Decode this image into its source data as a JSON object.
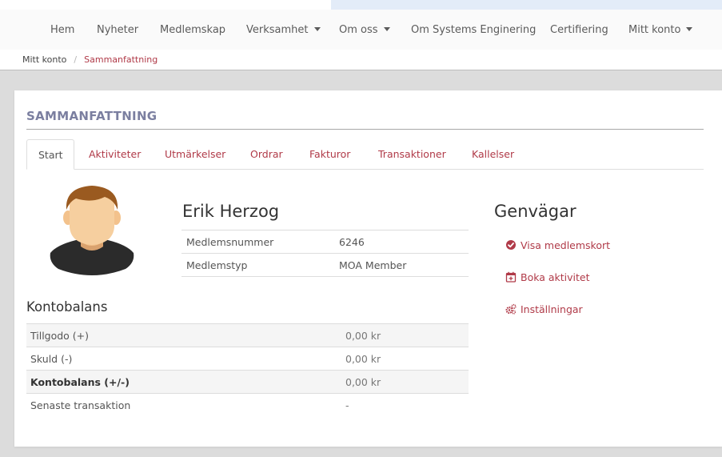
{
  "nav": {
    "items": [
      {
        "label": "Hem",
        "dropdown": false
      },
      {
        "label": "Nyheter",
        "dropdown": false
      },
      {
        "label": "Medlemskap",
        "dropdown": false
      },
      {
        "label": "Verksamhet",
        "dropdown": true
      },
      {
        "label": "Om oss",
        "dropdown": true
      },
      {
        "label": "Om Systems Enginering",
        "dropdown": false
      },
      {
        "label": "Certifiering",
        "dropdown": false
      },
      {
        "label": "Mitt konto",
        "dropdown": true
      }
    ]
  },
  "breadcrumb": {
    "home": "Mitt konto",
    "separator": "/",
    "current": "Sammanfattning"
  },
  "page": {
    "title": "SAMMANFATTNING"
  },
  "tabs": [
    {
      "label": "Start",
      "active": true
    },
    {
      "label": "Aktiviteter",
      "active": false
    },
    {
      "label": "Utmärkelser",
      "active": false
    },
    {
      "label": "Ordrar",
      "active": false
    },
    {
      "label": "Fakturor",
      "active": false
    },
    {
      "label": "Transaktioner",
      "active": false
    },
    {
      "label": "Kallelser",
      "active": false
    }
  ],
  "profile": {
    "name": "Erik Herzog",
    "rows": [
      {
        "label": "Medlemsnummer",
        "value": "6246"
      },
      {
        "label": "Medlemstyp",
        "value": "MOA Member"
      }
    ]
  },
  "balance": {
    "title": "Kontobalans",
    "rows": [
      {
        "label": "Tillgodo (+)",
        "value": "0,00 kr"
      },
      {
        "label": "Skuld (-)",
        "value": "0,00 kr"
      },
      {
        "label": "Kontobalans (+/-)",
        "value": "0,00 kr"
      },
      {
        "label": "Senaste transaktion",
        "value": "-"
      }
    ]
  },
  "shortcuts": {
    "title": "Genvägar",
    "items": [
      {
        "label": "Visa medlemskort",
        "icon": "check-circle-icon"
      },
      {
        "label": "Boka aktivitet",
        "icon": "calendar-plus-icon"
      },
      {
        "label": "Inställningar",
        "icon": "cogs-icon"
      }
    ]
  },
  "colors": {
    "accent": "#b03a48",
    "title": "#7b7fa0",
    "page_bg": "#dcdcdc"
  }
}
